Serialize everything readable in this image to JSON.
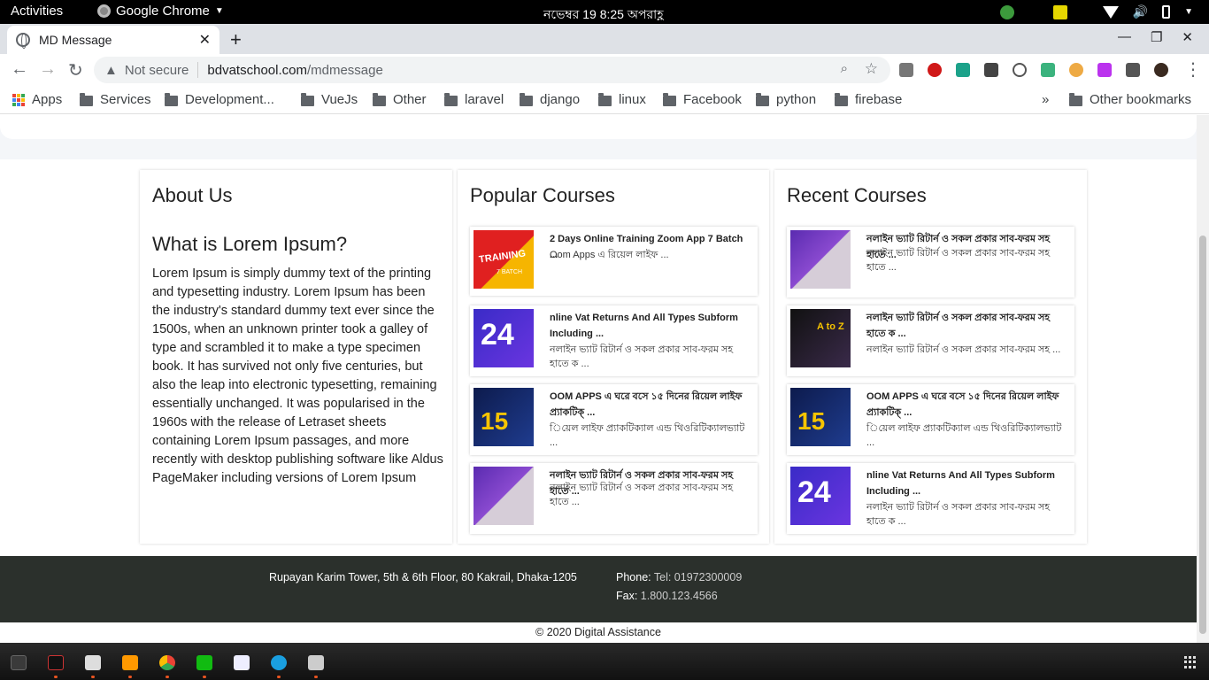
{
  "topbar": {
    "activities": "Activities",
    "app_name": "Google Chrome",
    "clock": "নভেম্বর 19   8:25 অপরাহ্ণ"
  },
  "browser": {
    "tab_title": "MD Message",
    "not_secure": "Not secure",
    "url_host": "bdvatschool.com",
    "url_path": "/mdmessage"
  },
  "bookmarks": {
    "apps": "Apps",
    "items": [
      "Services",
      "Development...",
      "VueJs",
      "Other",
      "laravel",
      "django",
      "linux",
      "Facebook",
      "python",
      "firebase"
    ],
    "more": "»",
    "other": "Other bookmarks"
  },
  "about": {
    "heading": "About Us",
    "subheading": "What is Lorem Ipsum?",
    "text": "Lorem Ipsum is simply dummy text of the printing and typesetting industry. Lorem Ipsum has been the industry's standard dummy text ever since the 1500s, when an unknown printer took a galley of type and scrambled it to make a type specimen book. It has survived not only five centuries, but also the leap into electronic typesetting, remaining essentially unchanged. It was popularised in the 1960s with the release of Letraset sheets containing Lorem Ipsum passages, and more recently with desktop publishing software like Aldus PageMaker including versions of Lorem Ipsum"
  },
  "popular": {
    "heading": "Popular Courses",
    "items": [
      {
        "title": "2 Days Online Training Zoom App 7 Batch ...",
        "desc": "Oom Apps এ রিয়েল লাইফ ..."
      },
      {
        "title": "nline Vat Returns And All Types Subform Including ...",
        "desc": "নলাইন ভ্যাট রিটার্ন ও সকল প্রকার সাব-ফরম সহ হাতে ক ..."
      },
      {
        "title": "OOM APPS এ ঘরে বসে ১৫ দিনের রিয়েল লাইফ প্র্যাকটিক্ ...",
        "desc": "িয়েল লাইফ প্র্যাকটিক্যাল এন্ড থিওরিটিক্যালভ্যাট ..."
      },
      {
        "title": "নলাইন ভ্যাট রিটার্ন ও সকল প্রকার সাব-ফরম সহ হাতে ...",
        "desc": "নলাইন ভ্যাট রিটার্ন ও সকল প্রকার সাব-ফরম সহ হাতে ..."
      }
    ]
  },
  "recent": {
    "heading": "Recent Courses",
    "items": [
      {
        "title": "নলাইন ভ্যাট রিটার্ন ও সকল প্রকার সাব-ফরম সহ হাতে ...",
        "desc": "নলাইন ভ্যাট রিটার্ন ও সকল প্রকার সাব-ফরম সহ হাতে ..."
      },
      {
        "title": "নলাইন ভ্যাট রিটার্ন ও সকল প্রকার সাব-ফরম সহ হাতে ক ...",
        "desc": "নলাইন ভ্যাট রিটার্ন ও সকল প্রকার সাব-ফরম সহ ..."
      },
      {
        "title": "OOM APPS এ ঘরে বসে ১৫ দিনের রিয়েল লাইফ প্র্যাকটিক্ ...",
        "desc": "িয়েল লাইফ প্র্যাকটিক্যাল এন্ড থিওরিটিক্যালভ্যাট ..."
      },
      {
        "title": "nline Vat Returns And All Types Subform Including ...",
        "desc": "নলাইন ভ্যাট রিটার্ন ও সকল প্রকার সাব-ফরম সহ হাতে ক ..."
      }
    ]
  },
  "thumbs": {
    "training_label": "TRAINING",
    "batch_label": "7 BATCH",
    "num_24": "24",
    "num_15": "15",
    "atoz": "A to Z"
  },
  "footer": {
    "address": "Rupayan Karim Tower, 5th & 6th Floor, 80 Kakrail, Dhaka-1205",
    "phone_label": "Phone: ",
    "phone": "Tel: 01972300009",
    "fax_label": "Fax: ",
    "fax": "1.800.123.4566",
    "copyright": "© 2020 Digital Assistance"
  },
  "colors": {
    "footer_bg": "#2b302c",
    "page_bg": "#f4f6f9",
    "dock_accent": "#e95420"
  }
}
